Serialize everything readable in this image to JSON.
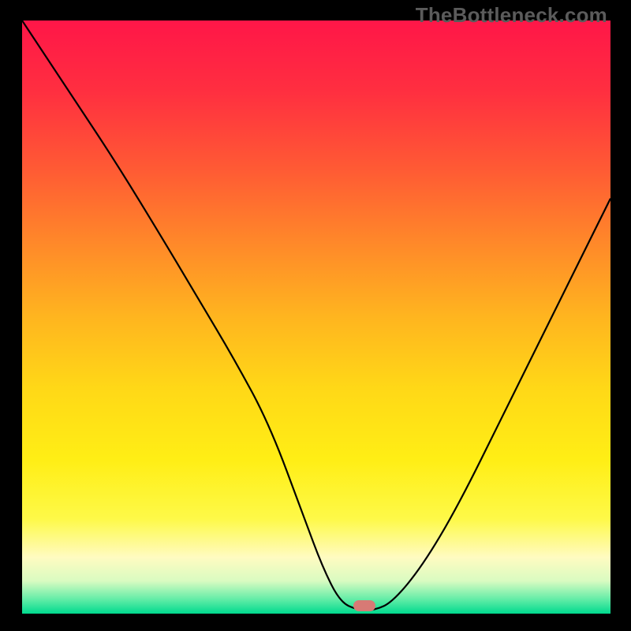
{
  "watermark": "TheBottleneck.com",
  "gradient_stops": [
    {
      "offset": 0.0,
      "color": "#ff1648"
    },
    {
      "offset": 0.12,
      "color": "#ff2f40"
    },
    {
      "offset": 0.25,
      "color": "#ff5a34"
    },
    {
      "offset": 0.38,
      "color": "#ff8a29"
    },
    {
      "offset": 0.5,
      "color": "#ffb51f"
    },
    {
      "offset": 0.62,
      "color": "#ffd817"
    },
    {
      "offset": 0.74,
      "color": "#ffee15"
    },
    {
      "offset": 0.84,
      "color": "#fef948"
    },
    {
      "offset": 0.905,
      "color": "#fffbc1"
    },
    {
      "offset": 0.945,
      "color": "#d9fbc1"
    },
    {
      "offset": 0.975,
      "color": "#66eda8"
    },
    {
      "offset": 1.0,
      "color": "#00da8e"
    }
  ],
  "marker": {
    "color": "#d77a75",
    "x_pct": 58.2,
    "y_pct": 98.7
  },
  "chart_data": {
    "type": "line",
    "title": "",
    "xlabel": "",
    "ylabel": "",
    "xlim": [
      0,
      100
    ],
    "ylim": [
      0,
      100
    ],
    "series": [
      {
        "name": "bottleneck-curve",
        "x": [
          0,
          8,
          16,
          24,
          30,
          36,
          42,
          48,
          51,
          54,
          57,
          60,
          63,
          68,
          74,
          82,
          90,
          100
        ],
        "y": [
          100,
          88,
          76,
          63,
          53,
          43,
          32,
          16,
          8,
          2,
          0.6,
          0.6,
          2,
          8,
          18,
          34,
          50,
          70
        ]
      }
    ],
    "annotations": [
      {
        "type": "marker",
        "x": 58,
        "y": 0.8,
        "label": "optimal-point"
      }
    ]
  }
}
